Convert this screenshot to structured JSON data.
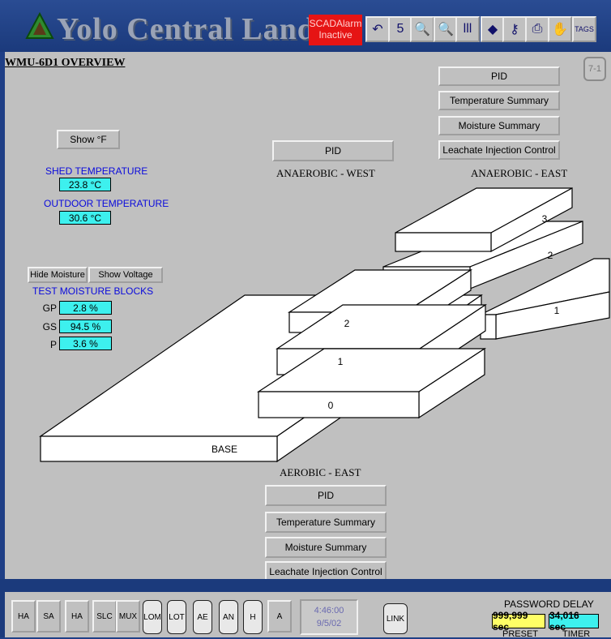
{
  "header": {
    "title": "Yolo Central Landfill",
    "alarm": {
      "line1": "SCADAlarm",
      "line2": "Inactive"
    },
    "toolbar": [
      {
        "icon": "undo-icon",
        "glyph": "↶"
      },
      {
        "icon": "s-icon",
        "glyph": "5"
      },
      {
        "icon": "search-globe-icon",
        "glyph": "🔍"
      },
      {
        "icon": "magnify-icon",
        "glyph": "🔍"
      },
      {
        "icon": "bar-chart-icon",
        "glyph": "lll"
      },
      {
        "icon": "book-icon",
        "glyph": "◆"
      },
      {
        "icon": "key-icon",
        "glyph": "⚷"
      },
      {
        "icon": "printer-icon",
        "glyph": "⎙"
      },
      {
        "icon": "hand-icon",
        "glyph": "✋"
      },
      {
        "icon": "tags-icon",
        "glyph": "TAGS"
      }
    ]
  },
  "page": {
    "title": "WMU-6D1 OVERVIEW",
    "badge": "7-1"
  },
  "temps": {
    "show_f_label": "Show °F",
    "shed_label": "SHED TEMPERATURE",
    "shed_value": "23.8 °C",
    "outdoor_label": "OUTDOOR TEMPERATURE",
    "outdoor_value": "30.6 °C"
  },
  "moisture": {
    "hide_label": "Hide Moisture",
    "voltage_label": "Show Voltage",
    "section_label": "TEST MOISTURE BLOCKS",
    "rows": [
      {
        "label": "GP",
        "value": "2.8 %"
      },
      {
        "label": "GS",
        "value": "94.5 %"
      },
      {
        "label": "P",
        "value": "3.6 %"
      }
    ]
  },
  "east_controls": {
    "pid": "PID",
    "temp": "Temperature Summary",
    "moisture": "Moisture Summary",
    "leachate": "Leachate Injection Control",
    "label": "ANAEROBIC - EAST"
  },
  "west": {
    "pid": "PID",
    "label": "ANAEROBIC - WEST"
  },
  "aerobic": {
    "label": "AEROBIC - EAST",
    "pid": "PID",
    "temp": "Temperature Summary",
    "moisture": "Moisture Summary",
    "leachate": "Leachate Injection Control"
  },
  "layers": {
    "base": "BASE",
    "west": [
      "0",
      "1",
      "2"
    ],
    "east": [
      "1",
      "2",
      "3"
    ]
  },
  "footer": {
    "buttons": [
      "HA",
      "SA",
      "HA",
      "SLC",
      "MUX",
      "LOM",
      "LOT",
      "AE",
      "AN",
      "H",
      "A"
    ],
    "time": "4:46:00",
    "date": "9/5/02",
    "link": "LINK",
    "password_delay": "PASSWORD DELAY",
    "preset_value": "999,999 sec",
    "timer_value": "34,016 sec",
    "preset_label": "PRESET",
    "timer_label": "TIMER"
  }
}
